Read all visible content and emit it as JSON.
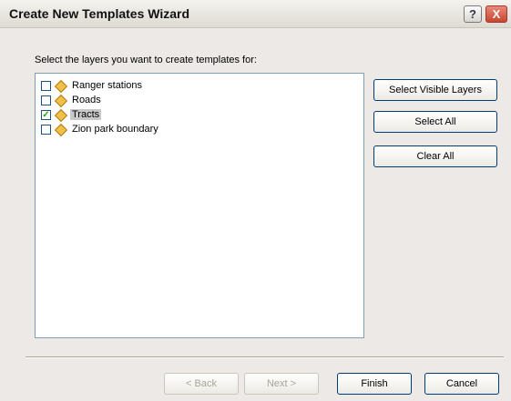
{
  "window": {
    "title": "Create New Templates Wizard",
    "help_label": "?",
    "close_label": "X"
  },
  "prompt": "Select the layers you want to create templates for:",
  "layers": [
    {
      "label": "Ranger stations",
      "checked": false,
      "selected": false,
      "icon": "point-layer-icon"
    },
    {
      "label": "Roads",
      "checked": false,
      "selected": false,
      "icon": "line-layer-icon"
    },
    {
      "label": "Tracts",
      "checked": true,
      "selected": true,
      "icon": "polygon-layer-icon"
    },
    {
      "label": "Zion park boundary",
      "checked": false,
      "selected": false,
      "icon": "polygon-layer-icon"
    }
  ],
  "side_buttons": {
    "select_visible": "Select Visible Layers",
    "select_all": "Select All",
    "clear_all": "Clear All"
  },
  "bottom_buttons": {
    "back": "< Back",
    "next": "Next >",
    "finish": "Finish",
    "cancel": "Cancel"
  }
}
